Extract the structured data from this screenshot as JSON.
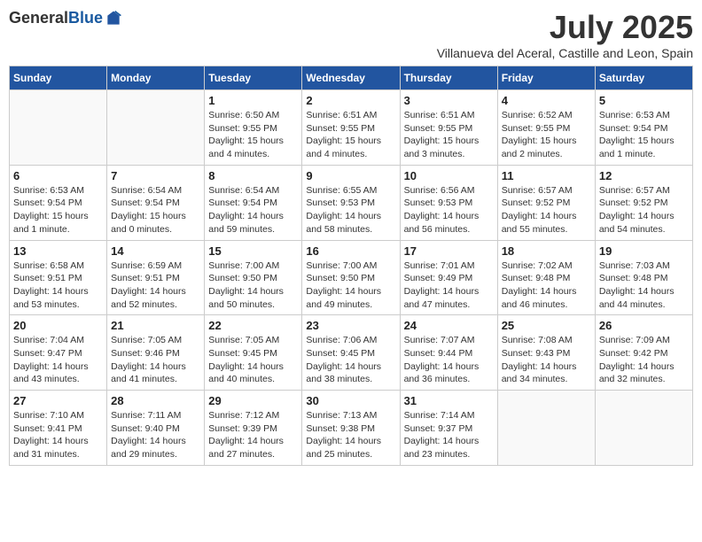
{
  "header": {
    "logo_general": "General",
    "logo_blue": "Blue",
    "month_title": "July 2025",
    "subtitle": "Villanueva del Aceral, Castille and Leon, Spain"
  },
  "weekdays": [
    "Sunday",
    "Monday",
    "Tuesday",
    "Wednesday",
    "Thursday",
    "Friday",
    "Saturday"
  ],
  "weeks": [
    [
      {
        "day": "",
        "detail": ""
      },
      {
        "day": "",
        "detail": ""
      },
      {
        "day": "1",
        "detail": "Sunrise: 6:50 AM\nSunset: 9:55 PM\nDaylight: 15 hours\nand 4 minutes."
      },
      {
        "day": "2",
        "detail": "Sunrise: 6:51 AM\nSunset: 9:55 PM\nDaylight: 15 hours\nand 4 minutes."
      },
      {
        "day": "3",
        "detail": "Sunrise: 6:51 AM\nSunset: 9:55 PM\nDaylight: 15 hours\nand 3 minutes."
      },
      {
        "day": "4",
        "detail": "Sunrise: 6:52 AM\nSunset: 9:55 PM\nDaylight: 15 hours\nand 2 minutes."
      },
      {
        "day": "5",
        "detail": "Sunrise: 6:53 AM\nSunset: 9:54 PM\nDaylight: 15 hours\nand 1 minute."
      }
    ],
    [
      {
        "day": "6",
        "detail": "Sunrise: 6:53 AM\nSunset: 9:54 PM\nDaylight: 15 hours\nand 1 minute."
      },
      {
        "day": "7",
        "detail": "Sunrise: 6:54 AM\nSunset: 9:54 PM\nDaylight: 15 hours\nand 0 minutes."
      },
      {
        "day": "8",
        "detail": "Sunrise: 6:54 AM\nSunset: 9:54 PM\nDaylight: 14 hours\nand 59 minutes."
      },
      {
        "day": "9",
        "detail": "Sunrise: 6:55 AM\nSunset: 9:53 PM\nDaylight: 14 hours\nand 58 minutes."
      },
      {
        "day": "10",
        "detail": "Sunrise: 6:56 AM\nSunset: 9:53 PM\nDaylight: 14 hours\nand 56 minutes."
      },
      {
        "day": "11",
        "detail": "Sunrise: 6:57 AM\nSunset: 9:52 PM\nDaylight: 14 hours\nand 55 minutes."
      },
      {
        "day": "12",
        "detail": "Sunrise: 6:57 AM\nSunset: 9:52 PM\nDaylight: 14 hours\nand 54 minutes."
      }
    ],
    [
      {
        "day": "13",
        "detail": "Sunrise: 6:58 AM\nSunset: 9:51 PM\nDaylight: 14 hours\nand 53 minutes."
      },
      {
        "day": "14",
        "detail": "Sunrise: 6:59 AM\nSunset: 9:51 PM\nDaylight: 14 hours\nand 52 minutes."
      },
      {
        "day": "15",
        "detail": "Sunrise: 7:00 AM\nSunset: 9:50 PM\nDaylight: 14 hours\nand 50 minutes."
      },
      {
        "day": "16",
        "detail": "Sunrise: 7:00 AM\nSunset: 9:50 PM\nDaylight: 14 hours\nand 49 minutes."
      },
      {
        "day": "17",
        "detail": "Sunrise: 7:01 AM\nSunset: 9:49 PM\nDaylight: 14 hours\nand 47 minutes."
      },
      {
        "day": "18",
        "detail": "Sunrise: 7:02 AM\nSunset: 9:48 PM\nDaylight: 14 hours\nand 46 minutes."
      },
      {
        "day": "19",
        "detail": "Sunrise: 7:03 AM\nSunset: 9:48 PM\nDaylight: 14 hours\nand 44 minutes."
      }
    ],
    [
      {
        "day": "20",
        "detail": "Sunrise: 7:04 AM\nSunset: 9:47 PM\nDaylight: 14 hours\nand 43 minutes."
      },
      {
        "day": "21",
        "detail": "Sunrise: 7:05 AM\nSunset: 9:46 PM\nDaylight: 14 hours\nand 41 minutes."
      },
      {
        "day": "22",
        "detail": "Sunrise: 7:05 AM\nSunset: 9:45 PM\nDaylight: 14 hours\nand 40 minutes."
      },
      {
        "day": "23",
        "detail": "Sunrise: 7:06 AM\nSunset: 9:45 PM\nDaylight: 14 hours\nand 38 minutes."
      },
      {
        "day": "24",
        "detail": "Sunrise: 7:07 AM\nSunset: 9:44 PM\nDaylight: 14 hours\nand 36 minutes."
      },
      {
        "day": "25",
        "detail": "Sunrise: 7:08 AM\nSunset: 9:43 PM\nDaylight: 14 hours\nand 34 minutes."
      },
      {
        "day": "26",
        "detail": "Sunrise: 7:09 AM\nSunset: 9:42 PM\nDaylight: 14 hours\nand 32 minutes."
      }
    ],
    [
      {
        "day": "27",
        "detail": "Sunrise: 7:10 AM\nSunset: 9:41 PM\nDaylight: 14 hours\nand 31 minutes."
      },
      {
        "day": "28",
        "detail": "Sunrise: 7:11 AM\nSunset: 9:40 PM\nDaylight: 14 hours\nand 29 minutes."
      },
      {
        "day": "29",
        "detail": "Sunrise: 7:12 AM\nSunset: 9:39 PM\nDaylight: 14 hours\nand 27 minutes."
      },
      {
        "day": "30",
        "detail": "Sunrise: 7:13 AM\nSunset: 9:38 PM\nDaylight: 14 hours\nand 25 minutes."
      },
      {
        "day": "31",
        "detail": "Sunrise: 7:14 AM\nSunset: 9:37 PM\nDaylight: 14 hours\nand 23 minutes."
      },
      {
        "day": "",
        "detail": ""
      },
      {
        "day": "",
        "detail": ""
      }
    ]
  ]
}
